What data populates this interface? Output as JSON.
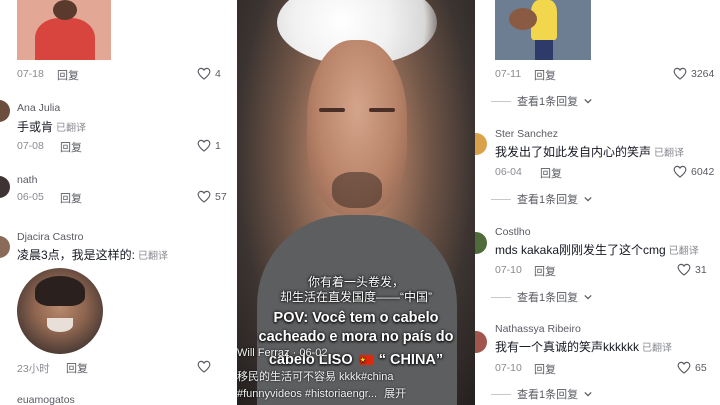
{
  "left": {
    "c0": {
      "date": "07-18",
      "reply": "回复",
      "likes": "4"
    },
    "c1": {
      "name": "Ana Julia",
      "text": "手或肯",
      "translated": "已翻译",
      "date": "07-08",
      "reply": "回复",
      "likes": "1"
    },
    "c2": {
      "name": "nath",
      "date": "06-05",
      "reply": "回复",
      "likes": "57"
    },
    "c3": {
      "name": "Djacira Castro",
      "text": "凌晨3点，我是这样的:",
      "translated": "已翻译"
    },
    "c4": {
      "date": "23小时",
      "reply": "回复"
    },
    "c5": {
      "name": "euamogatos"
    }
  },
  "video": {
    "subtitle_cn_1": "你有着一头卷发，",
    "subtitle_cn_2": "却生活在直发国度——“中国”",
    "subtitle_pt_1": "POV: Você tem o cabelo",
    "subtitle_pt_2": "cacheado e mora no país do",
    "subtitle_pt_3a": "cabelo LISO",
    "subtitle_pt_3b": "“ CHINA”",
    "author": "Will Ferraz · 06-02",
    "caption_1": "移民的生活可不容易 kkkk#china",
    "caption_2": "#funnyvideos #historiaengr...",
    "expand": "展开"
  },
  "right": {
    "c0": {
      "date": "07-11",
      "reply": "回复",
      "likes": "3264"
    },
    "more0": "查看1条回复",
    "c1": {
      "name": "Ster Sanchez",
      "text": "我发出了如此发自内心的笑声",
      "translated": "已翻译",
      "date": "06-04",
      "reply": "回复",
      "likes": "6042"
    },
    "more1": "查看1条回复",
    "c2": {
      "name": "Costlho",
      "text": "mds kakaka刚刚发生了这个cmg",
      "translated": "已翻译",
      "date": "07-10",
      "reply": "回复",
      "likes": "31"
    },
    "more2": "查看1条回复",
    "c3": {
      "name": "Nathassya Ribeiro",
      "text": "我有一个真诚的笑声kkkkkk",
      "translated": "已翻译",
      "date": "07-10",
      "reply": "回复",
      "likes": "65"
    },
    "more3": "查看1条回复"
  },
  "colors": {
    "text": "#161823",
    "muted": "#8a8b91",
    "background": "#ffffff"
  }
}
